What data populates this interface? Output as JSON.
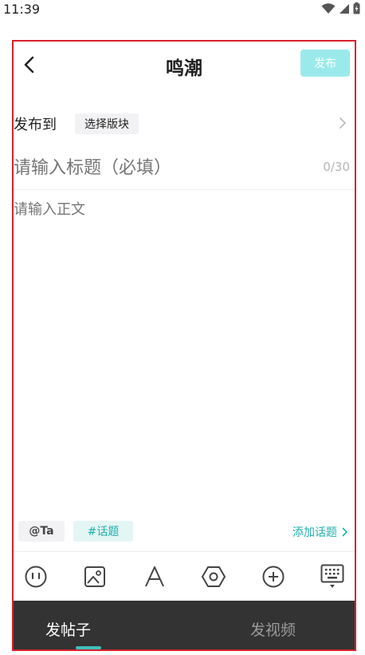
{
  "status_bar": {
    "time": "11:39"
  },
  "header": {
    "title": "鸣潮",
    "publish_label": "发布"
  },
  "post_to": {
    "label": "发布到",
    "section_placeholder": "选择版块"
  },
  "title_field": {
    "placeholder": "请输入标题（必填）",
    "counter": "0/30"
  },
  "body_field": {
    "placeholder": "请输入正文"
  },
  "tags": {
    "at_label": "@Ta",
    "topic_label": "#话题",
    "add_topic_label": "添加话题"
  },
  "toolbar": {
    "icons": [
      "emoji-icon",
      "image-icon",
      "text-format-icon",
      "settings-hex-icon",
      "add-circle-icon",
      "keyboard-icon"
    ]
  },
  "bottom_tabs": {
    "post_label": "发帖子",
    "video_label": "发视频"
  },
  "colors": {
    "accent": "#1fb0ad",
    "publish_disabled": "#9beaeb",
    "frame": "#d9202a",
    "tabbar": "#333333"
  }
}
